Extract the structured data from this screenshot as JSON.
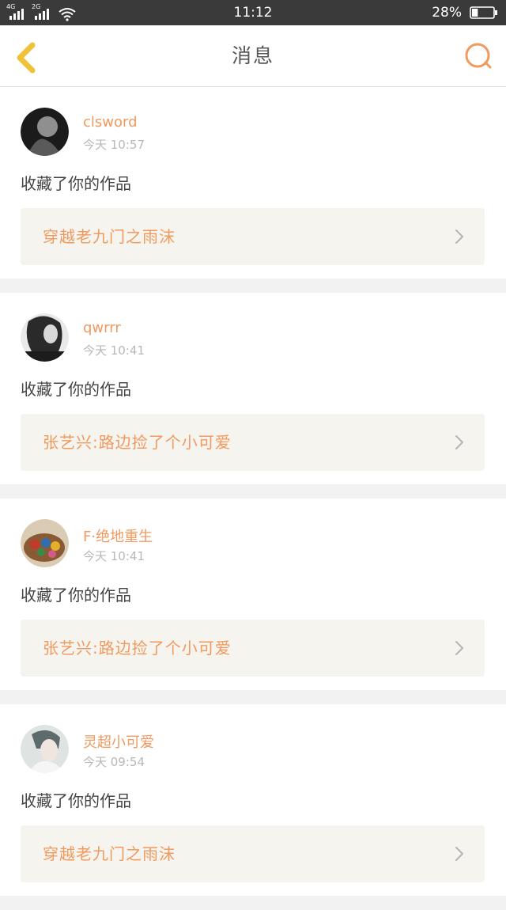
{
  "status_bar": {
    "network1": "4G",
    "network2": "2G",
    "time": "11:12",
    "battery_percent": "28%",
    "battery_level": 0.28
  },
  "nav": {
    "title": "消息",
    "back_icon": "chevron-left-icon",
    "search_icon": "search-icon"
  },
  "notifications": [
    {
      "username": "clsword",
      "time": "今天 10:57",
      "action": "收藏了你的作品",
      "work_title": "穿越老九门之雨沫",
      "avatar_colors": [
        "#1b1b1b",
        "#9a9a9a"
      ]
    },
    {
      "username": "qwrrr",
      "time": "今天 10:41",
      "action": "收藏了你的作品",
      "work_title": "张艺兴:路边捡了个小可爱",
      "avatar_colors": [
        "#2a2a2a",
        "#e8e8e8"
      ]
    },
    {
      "username": "F·绝地重生",
      "time": "今天 10:41",
      "action": "收藏了你的作品",
      "work_title": "张艺兴:路边捡了个小可爱",
      "avatar_colors": [
        "#c9b7a0",
        "#7a5a3a"
      ]
    },
    {
      "username": "灵超小可爱",
      "time": "今天 09:54",
      "action": "收藏了你的作品",
      "work_title": "穿越老九门之雨沫",
      "avatar_colors": [
        "#cfd6d4",
        "#6c7a7c"
      ]
    }
  ],
  "colors": {
    "accent": "#f19a5f",
    "back_icon": "#f0c23a",
    "search_icon": "#f19a5f"
  }
}
